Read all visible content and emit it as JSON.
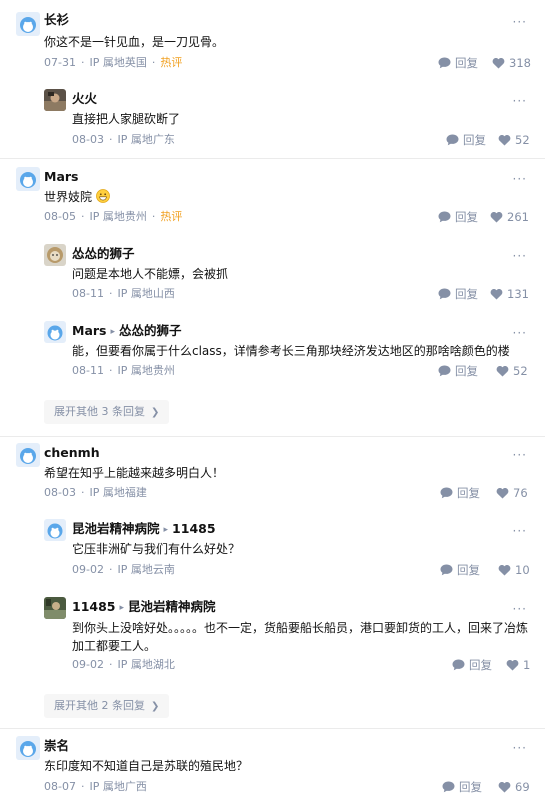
{
  "labels": {
    "reply": "回复",
    "ip_prefix": "IP 属地",
    "hot": "热评",
    "more": "···"
  },
  "threads": [
    {
      "main": {
        "name": "长衫",
        "text": "你这不是一针见血，是一刀见骨。",
        "date": "07-31",
        "ip": "IP 属地英国",
        "hot": "热评",
        "likes": "318",
        "avatar": "blue-cat"
      },
      "replies": [
        {
          "name": "火火",
          "text": "直接把人家腿砍断了",
          "date": "08-03",
          "ip": "IP 属地广东",
          "likes": "52",
          "avatar": "photo"
        }
      ]
    },
    {
      "main": {
        "name": "Mars",
        "text": "世界妓院",
        "emoji": "grin-emoji",
        "date": "08-05",
        "ip": "IP 属地贵州",
        "hot": "热评",
        "likes": "261",
        "avatar": "blue-cat"
      },
      "replies": [
        {
          "name": "怂怂的狮子",
          "text": "问题是本地人不能嫖，会被抓",
          "date": "08-11",
          "ip": "IP 属地山西",
          "likes": "131",
          "avatar": "lion"
        },
        {
          "name": "Mars",
          "to": "怂怂的狮子",
          "text": "能，但要看你属于什么class，详情参考长三角那块经济发达地区的那啥啥颜色的楼",
          "date": "08-11",
          "ip": "IP 属地贵州",
          "likes": "52",
          "avatar": "blue-cat"
        }
      ],
      "expand": "展开其他 3 条回复"
    },
    {
      "main": {
        "name": "chenmh",
        "text": "希望在知乎上能越来越多明白人！",
        "date": "08-03",
        "ip": "IP 属地福建",
        "likes": "76",
        "avatar": "blue-cat"
      },
      "replies": [
        {
          "name": "昆池岩精神病院",
          "to": "11485",
          "text": "它压非洲矿与我们有什么好处？",
          "date": "09-02",
          "ip": "IP 属地云南",
          "likes": "10",
          "avatar": "blue-cat"
        },
        {
          "name": "11485",
          "to": "昆池岩精神病院",
          "text": "到你头上没啥好处。。。。。也不一定，货船要船长船员，港口要卸货的工人，回来了冶炼加工都要工人。",
          "date": "09-02",
          "ip": "IP 属地湖北",
          "likes": "1",
          "avatar": "photo2"
        }
      ],
      "expand": "展开其他 2 条回复"
    },
    {
      "main": {
        "name": "崇名",
        "text": "东印度知不知道自己是苏联的殖民地？",
        "date": "08-07",
        "ip": "IP 属地广西",
        "likes": "69",
        "avatar": "blue-cat"
      },
      "replies": []
    }
  ],
  "colors": {
    "meta": "#8590a6",
    "hot": "#f1a020",
    "text": "#121212",
    "avatar_blue": "#4e9ee8"
  }
}
